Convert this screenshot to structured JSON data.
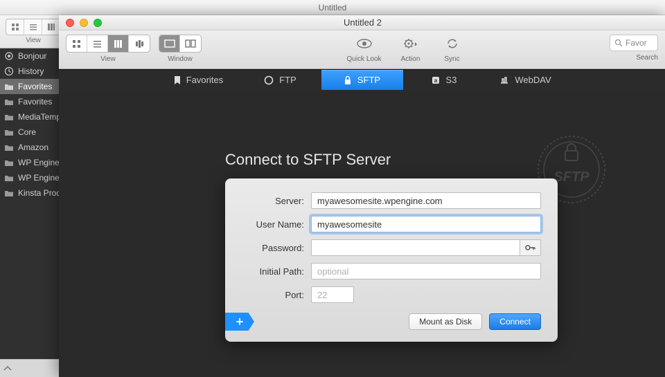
{
  "bg": {
    "title": "Untitled",
    "view_label": "View",
    "sidebar": [
      {
        "icon": "bonjour",
        "label": "Bonjour"
      },
      {
        "icon": "history",
        "label": "History"
      },
      {
        "icon": "folder",
        "label": "Favorites",
        "selected": true
      },
      {
        "icon": "folder",
        "label": "Favorites"
      },
      {
        "icon": "folder",
        "label": "MediaTemp"
      },
      {
        "icon": "folder",
        "label": "Core"
      },
      {
        "icon": "folder",
        "label": "Amazon"
      },
      {
        "icon": "folder",
        "label": "WP Engine"
      },
      {
        "icon": "folder",
        "label": "WP Engine"
      },
      {
        "icon": "folder",
        "label": "Kinsta Prod"
      }
    ]
  },
  "fg": {
    "title": "Untitled 2",
    "toolbar": {
      "view_label": "View",
      "window_label": "Window",
      "quicklook_label": "Quick Look",
      "action_label": "Action",
      "sync_label": "Sync",
      "search_label": "Search",
      "search_placeholder": "Favor"
    },
    "tabs": [
      {
        "icon": "bookmark",
        "label": "Favorites"
      },
      {
        "icon": "circle",
        "label": "FTP"
      },
      {
        "icon": "lock",
        "label": "SFTP",
        "active": true
      },
      {
        "icon": "cube",
        "label": "S3"
      },
      {
        "icon": "webdav",
        "label": "WebDAV"
      }
    ],
    "heading": "Connect to SFTP Server",
    "stamp": "SFTP",
    "form": {
      "server_label": "Server:",
      "server_value": "myawesomesite.wpengine.com",
      "username_label": "User Name:",
      "username_value": "myawesomesite",
      "password_label": "Password:",
      "password_value": "",
      "initialpath_label": "Initial Path:",
      "initialpath_placeholder": "optional",
      "port_label": "Port:",
      "port_placeholder": "22",
      "mount_label": "Mount as Disk",
      "connect_label": "Connect"
    }
  }
}
